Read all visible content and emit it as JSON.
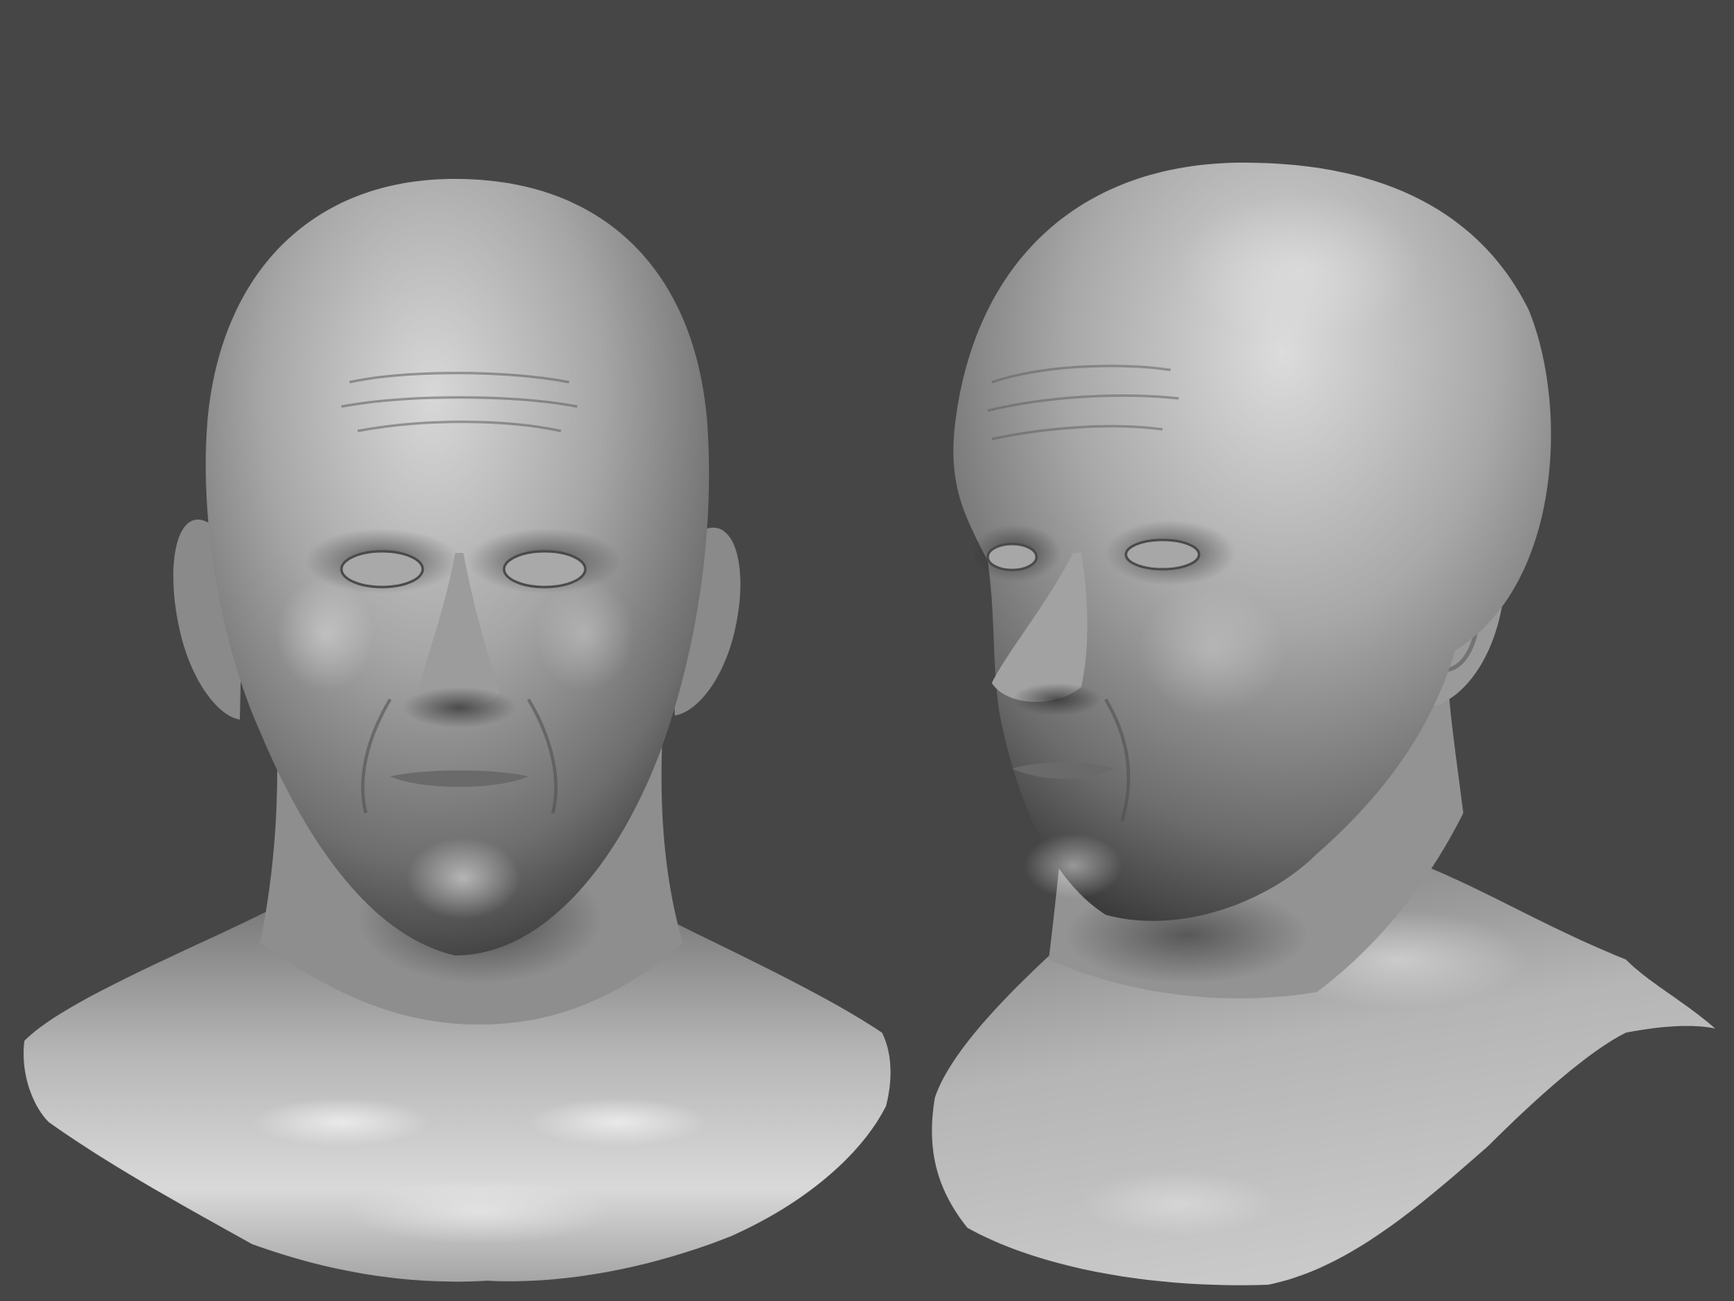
{
  "scene": {
    "background_color": "#464646",
    "material_color": "#b9b9b9",
    "views": [
      {
        "view": "front",
        "icon": "sculpted-head-front"
      },
      {
        "view": "three-quarter",
        "icon": "sculpted-head-three-quarter"
      }
    ]
  }
}
